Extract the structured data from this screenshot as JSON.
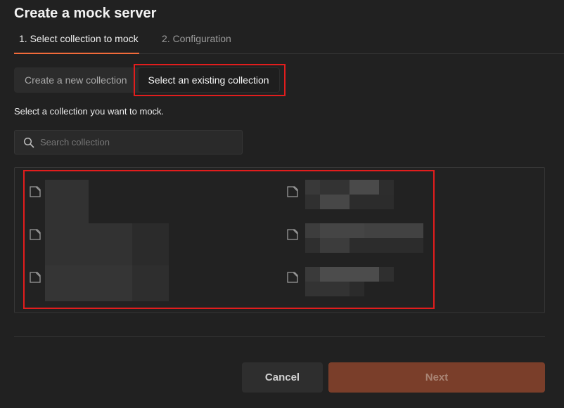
{
  "title": "Create a mock server",
  "steps": [
    {
      "label": "1.  Select collection to mock",
      "active": true
    },
    {
      "label": "2.  Configuration",
      "active": false
    }
  ],
  "source_tabs": {
    "new": "Create a new collection",
    "existing": "Select an existing collection",
    "selected": "existing"
  },
  "instruction": "Select a collection you want to mock.",
  "search": {
    "placeholder": "Search collection",
    "value": ""
  },
  "collections": [
    {
      "icon": "collection-icon",
      "name": ""
    },
    {
      "icon": "collection-icon",
      "name": ""
    },
    {
      "icon": "collection-icon",
      "name": ""
    },
    {
      "icon": "collection-icon",
      "name": ""
    },
    {
      "icon": "collection-icon",
      "name": ""
    },
    {
      "icon": "collection-icon",
      "name": ""
    }
  ],
  "buttons": {
    "cancel": "Cancel",
    "next": "Next"
  },
  "colors": {
    "accent": "#f26b3a",
    "next_bg": "#7a3e2a",
    "highlight": "#e21d1d",
    "bg": "#212121"
  }
}
